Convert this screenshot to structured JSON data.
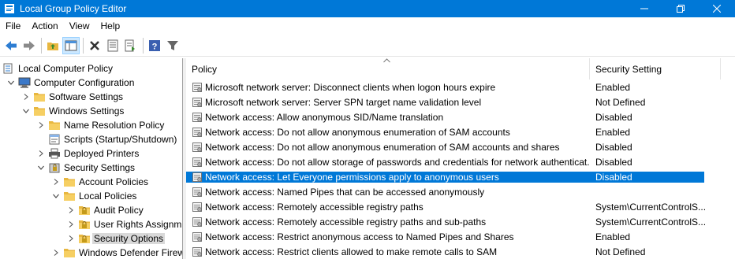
{
  "window": {
    "title": "Local Group Policy Editor",
    "accent": "#0078d7"
  },
  "menu": [
    "File",
    "Action",
    "View",
    "Help"
  ],
  "toolbar": [
    "back-icon",
    "forward-icon",
    "up-folder-icon",
    "show-hide-tree-icon",
    "delete-icon",
    "properties-icon",
    "export-list-icon",
    "help-icon",
    "filter-icon"
  ],
  "tree": {
    "items": [
      {
        "label": "Local Computer Policy",
        "level": 0,
        "toggle": "none",
        "icon": "computer-policy-icon"
      },
      {
        "label": "Computer Configuration",
        "level": 1,
        "toggle": "expanded",
        "icon": "computer-icon"
      },
      {
        "label": "Software Settings",
        "level": 2,
        "toggle": "collapsed",
        "icon": "folder-icon"
      },
      {
        "label": "Windows Settings",
        "level": 2,
        "toggle": "expanded",
        "icon": "folder-icon"
      },
      {
        "label": "Name Resolution Policy",
        "level": 3,
        "toggle": "collapsed",
        "icon": "folder-icon"
      },
      {
        "label": "Scripts (Startup/Shutdown)",
        "level": 3,
        "toggle": "none",
        "icon": "script-icon"
      },
      {
        "label": "Deployed Printers",
        "level": 3,
        "toggle": "collapsed",
        "icon": "printer-icon"
      },
      {
        "label": "Security Settings",
        "level": 3,
        "toggle": "expanded",
        "icon": "security-icon"
      },
      {
        "label": "Account Policies",
        "level": 4,
        "toggle": "collapsed",
        "icon": "folder-icon"
      },
      {
        "label": "Local Policies",
        "level": 4,
        "toggle": "expanded",
        "icon": "folder-icon"
      },
      {
        "label": "Audit Policy",
        "level": 5,
        "toggle": "collapsed",
        "icon": "locked-folder-icon"
      },
      {
        "label": "User Rights Assignm",
        "level": 5,
        "toggle": "collapsed",
        "icon": "locked-folder-icon"
      },
      {
        "label": "Security Options",
        "level": 5,
        "toggle": "collapsed",
        "icon": "locked-folder-icon",
        "selected": true
      },
      {
        "label": "Windows Defender Firew",
        "level": 4,
        "toggle": "collapsed",
        "icon": "folder-icon"
      }
    ]
  },
  "list": {
    "columns": [
      "Policy",
      "Security Setting"
    ],
    "rows": [
      {
        "policy": "Microsoft network server: Disconnect clients when logon hours expire",
        "setting": "Enabled"
      },
      {
        "policy": "Microsoft network server: Server SPN target name validation level",
        "setting": "Not Defined"
      },
      {
        "policy": "Network access: Allow anonymous SID/Name translation",
        "setting": "Disabled"
      },
      {
        "policy": "Network access: Do not allow anonymous enumeration of SAM accounts",
        "setting": "Enabled"
      },
      {
        "policy": "Network access: Do not allow anonymous enumeration of SAM accounts and shares",
        "setting": "Disabled"
      },
      {
        "policy": "Network access: Do not allow storage of passwords and credentials for network authenticat...",
        "setting": "Disabled"
      },
      {
        "policy": "Network access: Let Everyone permissions apply to anonymous users",
        "setting": "Disabled",
        "selected": true
      },
      {
        "policy": "Network access: Named Pipes that can be accessed anonymously",
        "setting": ""
      },
      {
        "policy": "Network access: Remotely accessible registry paths",
        "setting": "System\\CurrentControlS..."
      },
      {
        "policy": "Network access: Remotely accessible registry paths and sub-paths",
        "setting": "System\\CurrentControlS..."
      },
      {
        "policy": "Network access: Restrict anonymous access to Named Pipes and Shares",
        "setting": "Enabled"
      },
      {
        "policy": "Network access: Restrict clients allowed to make remote calls to SAM",
        "setting": "Not Defined"
      }
    ]
  }
}
